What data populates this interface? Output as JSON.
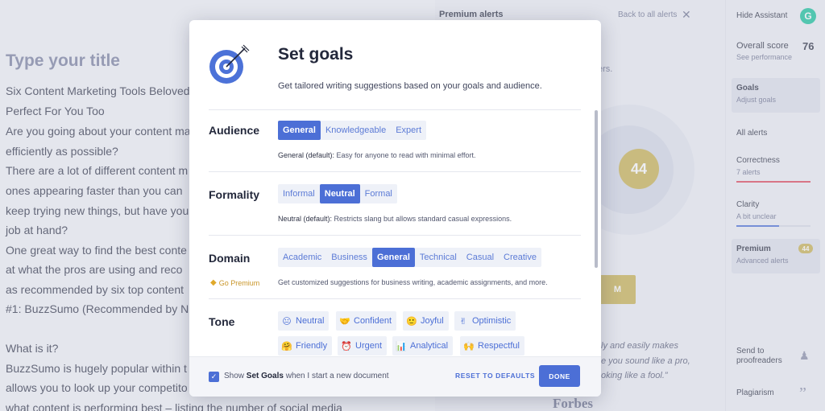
{
  "editor": {
    "title": "Type your title",
    "lines": [
      "Six Content Marketing Tools Beloved",
      "Perfect For You Too",
      "Are you going about your content ma",
      "efficiently as possible?",
      "There are a lot of different content m",
      "ones appearing faster than you can",
      "keep trying new things, but have you",
      "job at hand?",
      "One great way to find the best conte",
      "at what the pros are using and reco",
      "as recommended by six top content",
      "#1: BuzzSumo (Recommended by N",
      "",
      "What is it?",
      "BuzzSumo is hugely popular within t",
      "allows you to look up your competito",
      "what content is performing best – listing the number of social media"
    ]
  },
  "alerts_panel": {
    "title": "Premium alerts",
    "back_link": "Back to all alerts",
    "fragment": "ers.",
    "score": "44",
    "button_fragment": "M",
    "quote_lines": [
      "ly and easily makes",
      "e you sound like a pro,",
      "oking like a fool.”"
    ],
    "source": "Forbes"
  },
  "sidebar": {
    "hide_label": "Hide Assistant",
    "logo_letter": "G",
    "overall_score_label": "Overall score",
    "overall_score_value": "76",
    "overall_score_sub": "See performance",
    "goals_label": "Goals",
    "goals_sub": "Adjust goals",
    "all_alerts": "All alerts",
    "correctness_label": "Correctness",
    "correctness_sub": "7 alerts",
    "correctness_fill": 1.0,
    "correctness_color": "#e0475a",
    "clarity_label": "Clarity",
    "clarity_sub": "A bit unclear",
    "clarity_fill": 0.58,
    "clarity_color": "#4c6fd6",
    "premium_label": "Premium",
    "premium_sub": "Advanced alerts",
    "premium_count": "44",
    "send_label_1": "Send to",
    "send_label_2": "proofreaders",
    "plagiarism_label": "Plagiarism"
  },
  "modal": {
    "title": "Set goals",
    "subtitle": "Get tailored writing suggestions based on your goals and audience.",
    "audience": {
      "label": "Audience",
      "options": [
        "General",
        "Knowledgeable",
        "Expert"
      ],
      "selected": "General",
      "desc_bold": "General (default):",
      "desc": " Easy for anyone to read with minimal effort."
    },
    "formality": {
      "label": "Formality",
      "options": [
        "Informal",
        "Neutral",
        "Formal"
      ],
      "selected": "Neutral",
      "desc_bold": "Neutral (default):",
      "desc": " Restricts slang but allows standard casual expressions."
    },
    "domain": {
      "label": "Domain",
      "go_premium": "Go Premium",
      "options": [
        "Academic",
        "Business",
        "General",
        "Technical",
        "Casual",
        "Creative"
      ],
      "selected": "General",
      "desc": "Get customized suggestions for business writing, academic assignments, and more."
    },
    "tone": {
      "label": "Tone",
      "chips": [
        {
          "emoji": "😐",
          "label": "Neutral"
        },
        {
          "emoji": "🤝",
          "label": "Confident"
        },
        {
          "emoji": "🙂",
          "label": "Joyful"
        },
        {
          "emoji": "✌",
          "label": "Optimistic"
        },
        {
          "emoji": "🤗",
          "label": "Friendly"
        },
        {
          "emoji": "⏰",
          "label": "Urgent"
        },
        {
          "emoji": "📊",
          "label": "Analytical"
        },
        {
          "emoji": "🙌",
          "label": "Respectful"
        }
      ]
    },
    "footer": {
      "checkbox_checked": true,
      "text_before": "Show ",
      "text_bold": "Set Goals",
      "text_after": " when I start a new document",
      "reset_label": "RESET TO DEFAULTS",
      "done_label": "DONE"
    }
  }
}
